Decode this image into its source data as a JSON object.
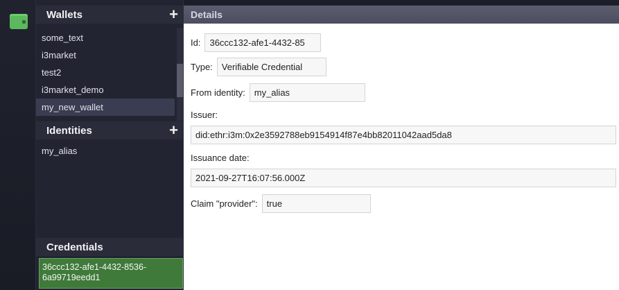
{
  "sidebar": {
    "wallets": {
      "title": "Wallets",
      "add": "+",
      "items": [
        "some_text",
        "i3market",
        "test2",
        "i3market_demo",
        "my_new_wallet"
      ]
    },
    "identities": {
      "title": "Identities",
      "add": "+",
      "items": [
        "my_alias"
      ]
    },
    "credentials": {
      "title": "Credentials",
      "items": [
        "36ccc132-afe1-4432-8536-6a99719eedd1"
      ]
    }
  },
  "details": {
    "title": "Details",
    "id_label": "Id:",
    "id_value": "36ccc132-afe1-4432-85",
    "type_label": "Type:",
    "type_value": "Verifiable Credential",
    "from_label": "From identity:",
    "from_value": "my_alias",
    "issuer_label": "Issuer:",
    "issuer_value": "did:ethr:i3m:0x2e3592788eb9154914f87e4bb82011042aad5da8",
    "issuance_label": "Issuance date:",
    "issuance_value": "2021-09-27T16:07:56.000Z",
    "claim_label": "Claim \"provider\":",
    "claim_value": "true"
  },
  "colors": {
    "accent_green": "#5cb85c",
    "selected_credential": "#3f7a3a",
    "sidebar_bg": "#222431"
  }
}
